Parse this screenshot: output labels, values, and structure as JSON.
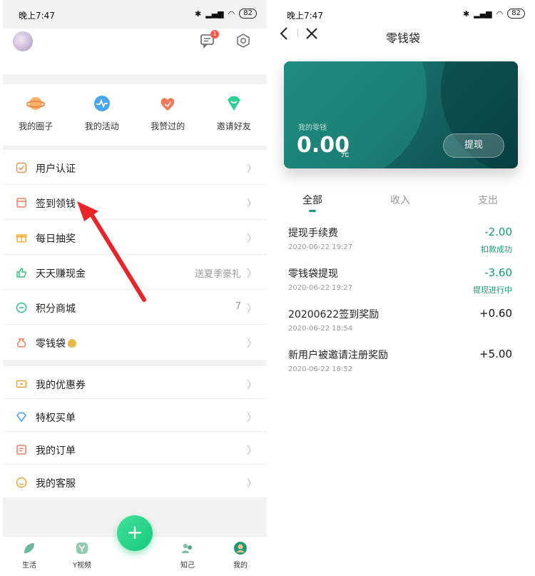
{
  "status_bar": {
    "time": "晚上7:47",
    "battery": "82"
  },
  "left": {
    "message_badge": "1",
    "quick_actions": [
      {
        "label": "我的圈子",
        "icon": "planet-icon",
        "color": "#f5a25a"
      },
      {
        "label": "我的活动",
        "icon": "activity-icon",
        "color": "#4aa6ee"
      },
      {
        "label": "我赞过的",
        "icon": "heart-icon",
        "color": "#f27a5a"
      },
      {
        "label": "邀请好友",
        "icon": "gem-icon",
        "color": "#2fcf93"
      }
    ],
    "menu_group1": [
      {
        "label": "用户认证",
        "value": ""
      },
      {
        "label": "签到领钱",
        "value": ""
      },
      {
        "label": "每日抽奖",
        "value": ""
      },
      {
        "label": "天天赚现金",
        "value": "送夏季豪礼"
      },
      {
        "label": "积分商城",
        "value": "7"
      },
      {
        "label": "零钱袋",
        "value": ""
      }
    ],
    "menu_group2": [
      {
        "label": "我的优惠券"
      },
      {
        "label": "特权买单"
      },
      {
        "label": "我的订单"
      },
      {
        "label": "我的客服"
      }
    ],
    "tabbar": [
      {
        "label": "生活"
      },
      {
        "label": "Y视频"
      },
      {
        "label": ""
      },
      {
        "label": "知己"
      },
      {
        "label": "我的"
      }
    ],
    "fab_label": "+"
  },
  "right": {
    "title": "零钱袋",
    "card": {
      "label": "我的零钱",
      "amount": "0.00",
      "unit": "元",
      "withdraw_button": "提现"
    },
    "tabs": [
      "全部",
      "收入",
      "支出"
    ],
    "records": [
      {
        "title": "提现手续费",
        "time": "2020-06-22 19:27",
        "amount": "-2.00",
        "status": "扣款成功"
      },
      {
        "title": "零钱袋提现",
        "time": "2020-06-22 19:27",
        "amount": "-3.60",
        "status": "提现进行中"
      },
      {
        "title": "20200622签到奖励",
        "time": "2020-06-22 18:54",
        "amount": "+0.60",
        "status": ""
      },
      {
        "title": "新用户被邀请注册奖励",
        "time": "2020-06-22 18:52",
        "amount": "+5.00",
        "status": ""
      }
    ]
  },
  "colors": {
    "accent_green": "#1a9b79",
    "card_teal": "#166a67",
    "fab_green": "#22d086",
    "arrow_red": "#e8252b"
  }
}
